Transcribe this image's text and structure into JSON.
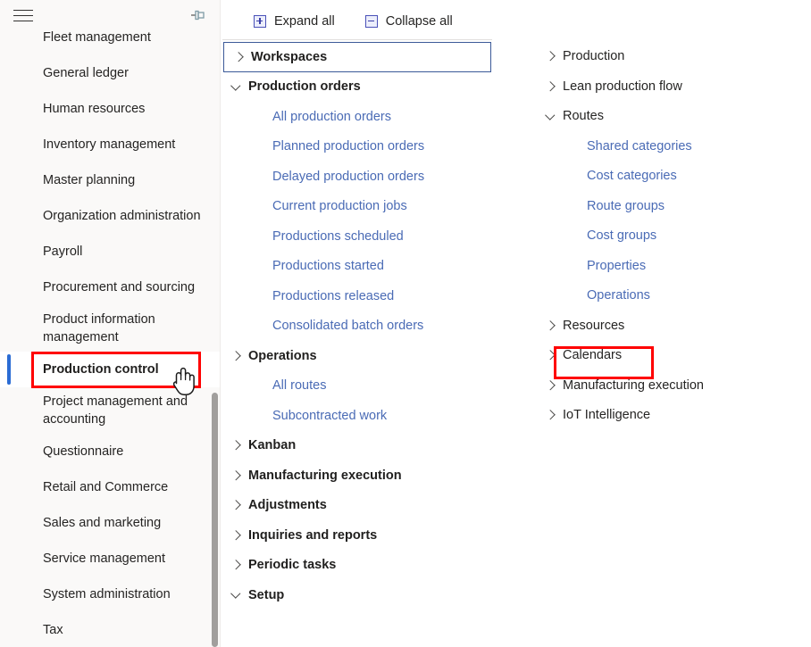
{
  "app": {
    "title": "Dynamics 365 navigation pane",
    "accent_color": "#2b6cd4",
    "link_color": "#4a6bb5",
    "highlight_color": "#ff0000"
  },
  "sidebar": {
    "menu_button_label": "Show / hide navigation pane",
    "pin_button_label": "Pin navigation pane",
    "items": [
      {
        "label": "Fleet management",
        "selected": false,
        "clipped": true
      },
      {
        "label": "General ledger",
        "selected": false
      },
      {
        "label": "Human resources",
        "selected": false
      },
      {
        "label": "Inventory management",
        "selected": false
      },
      {
        "label": "Master planning",
        "selected": false
      },
      {
        "label": "Organization administration",
        "selected": false
      },
      {
        "label": "Payroll",
        "selected": false
      },
      {
        "label": "Procurement and sourcing",
        "selected": false
      },
      {
        "label": "Product information management",
        "selected": false
      },
      {
        "label": "Production control",
        "selected": true
      },
      {
        "label": "Project management and accounting",
        "selected": false
      },
      {
        "label": "Questionnaire",
        "selected": false
      },
      {
        "label": "Retail and Commerce",
        "selected": false
      },
      {
        "label": "Sales and marketing",
        "selected": false
      },
      {
        "label": "Service management",
        "selected": false
      },
      {
        "label": "System administration",
        "selected": false
      },
      {
        "label": "Tax",
        "selected": false
      }
    ]
  },
  "flyout": {
    "toolbar": {
      "expand_all_label": "Expand all",
      "expand_all_icon": "box-plus-icon",
      "collapse_all_label": "Collapse all",
      "collapse_all_icon": "box-minus-icon"
    },
    "column_1": [
      {
        "label": "Workspaces",
        "type": "parent",
        "expanded": false,
        "focused": true
      },
      {
        "label": "Production orders",
        "type": "parent",
        "expanded": true
      },
      {
        "label": "All production orders",
        "type": "leaf"
      },
      {
        "label": "Planned production orders",
        "type": "leaf"
      },
      {
        "label": "Delayed production orders",
        "type": "leaf"
      },
      {
        "label": "Current production jobs",
        "type": "leaf"
      },
      {
        "label": "Productions scheduled",
        "type": "leaf"
      },
      {
        "label": "Productions started",
        "type": "leaf"
      },
      {
        "label": "Productions released",
        "type": "leaf"
      },
      {
        "label": "Consolidated batch orders",
        "type": "leaf"
      },
      {
        "label": "Operations",
        "type": "parent",
        "expanded": false
      },
      {
        "label": "All routes",
        "type": "leaf"
      },
      {
        "label": "Subcontracted work",
        "type": "leaf"
      },
      {
        "label": "Kanban",
        "type": "parent",
        "expanded": false
      },
      {
        "label": "Manufacturing execution",
        "type": "parent",
        "expanded": false
      },
      {
        "label": "Adjustments",
        "type": "parent",
        "expanded": false
      },
      {
        "label": "Inquiries and reports",
        "type": "parent",
        "expanded": false
      },
      {
        "label": "Periodic tasks",
        "type": "parent",
        "expanded": false
      },
      {
        "label": "Setup",
        "type": "parent",
        "expanded": true
      }
    ],
    "column_2": [
      {
        "label": "Production",
        "type": "parent-light",
        "expanded": false
      },
      {
        "label": "Lean production flow",
        "type": "parent-light",
        "expanded": false
      },
      {
        "label": "Routes",
        "type": "parent-light",
        "expanded": true
      },
      {
        "label": "Shared categories",
        "type": "leaf"
      },
      {
        "label": "Cost categories",
        "type": "leaf"
      },
      {
        "label": "Route groups",
        "type": "leaf"
      },
      {
        "label": "Cost groups",
        "type": "leaf"
      },
      {
        "label": "Properties",
        "type": "leaf"
      },
      {
        "label": "Operations",
        "type": "leaf"
      },
      {
        "label": "Resources",
        "type": "parent-light",
        "expanded": false,
        "highlighted": true
      },
      {
        "label": "Calendars",
        "type": "parent-light",
        "expanded": false
      },
      {
        "label": "Manufacturing execution",
        "type": "parent-light",
        "expanded": false
      },
      {
        "label": "IoT Intelligence",
        "type": "parent-light",
        "expanded": false
      }
    ]
  },
  "annotations": {
    "production_control_box": "Production control",
    "resources_box": "Resources",
    "cursor": "hand-pointer-cursor"
  }
}
